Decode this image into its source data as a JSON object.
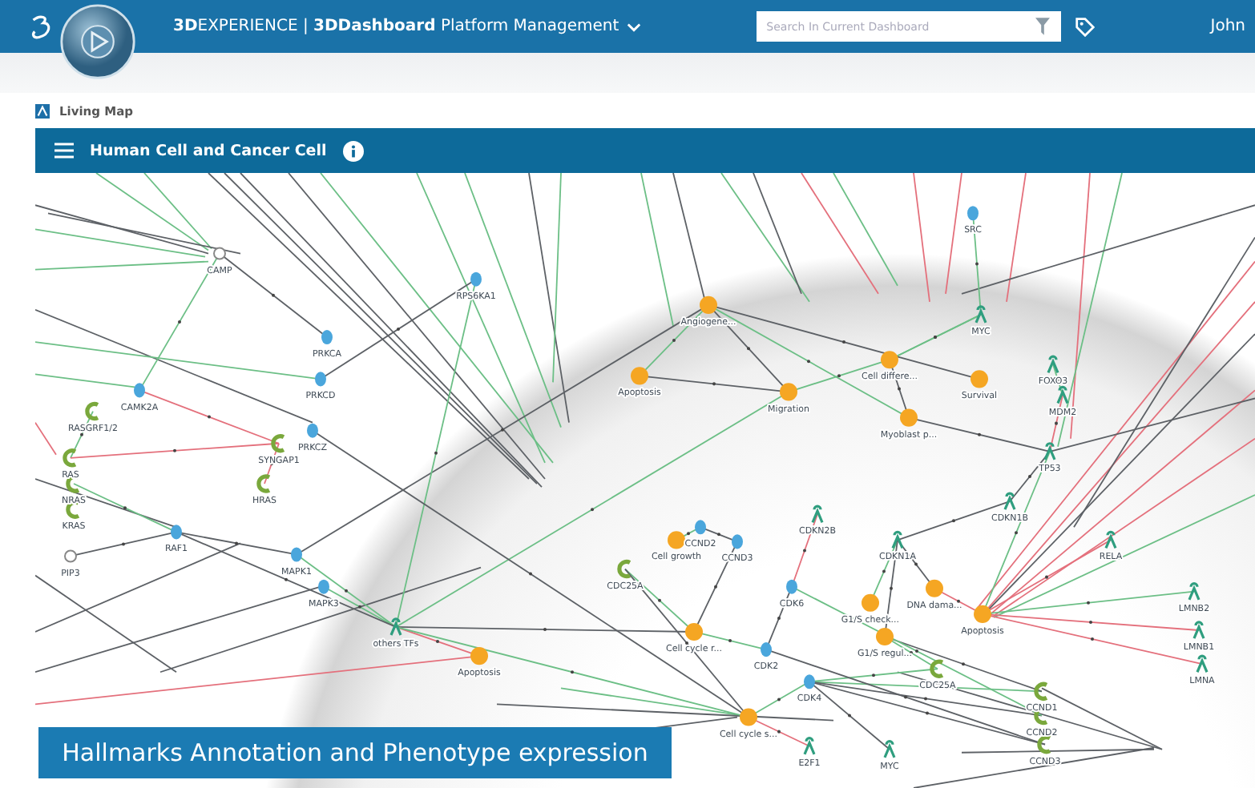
{
  "top_bar": {
    "title": "**3D**EXPERIENCE | **3DDashboard** Platform Management",
    "search": {
      "placeholder": "Search In Current Dashboard"
    },
    "user": "John"
  },
  "tab": {
    "label": "Living Map"
  },
  "panel": {
    "title": "Human Cell and Cancer Cell"
  },
  "map": {
    "nodes": [
      {
        "label": "SRC",
        "kind": "protein"
      },
      {
        "label": "CAMP",
        "kind": "molecule"
      },
      {
        "label": "RPS6KA1",
        "kind": "protein"
      },
      {
        "label": "Angiogene...",
        "kind": "phenotype"
      },
      {
        "label": "MYC",
        "kind": "gene"
      },
      {
        "label": "PRKCA",
        "kind": "protein"
      },
      {
        "label": "Cell differe...",
        "kind": "phenotype"
      },
      {
        "label": "FOXO3",
        "kind": "gene"
      },
      {
        "label": "PRKCD",
        "kind": "protein"
      },
      {
        "label": "Apoptosis",
        "kind": "phenotype"
      },
      {
        "label": "Survival",
        "kind": "phenotype"
      },
      {
        "label": "CAMK2A",
        "kind": "protein"
      },
      {
        "label": "Migration",
        "kind": "phenotype"
      },
      {
        "label": "MDM2",
        "kind": "gene"
      },
      {
        "label": "RASGRF1/2",
        "kind": "receptor"
      },
      {
        "label": "Myoblast p...",
        "kind": "phenotype"
      },
      {
        "label": "PRKCZ",
        "kind": "protein"
      },
      {
        "label": "SYNGAP1",
        "kind": "receptor"
      },
      {
        "label": "RAS",
        "kind": "receptor"
      },
      {
        "label": "TP53",
        "kind": "gene"
      },
      {
        "label": "NRAS",
        "kind": "receptor"
      },
      {
        "label": "HRAS",
        "kind": "receptor"
      },
      {
        "label": "KRAS",
        "kind": "receptor"
      },
      {
        "label": "CDKN1B",
        "kind": "gene"
      },
      {
        "label": "CDKN2B",
        "kind": "gene"
      },
      {
        "label": "RAF1",
        "kind": "protein"
      },
      {
        "label": "CCND2",
        "kind": "protein"
      },
      {
        "label": "Cell growth",
        "kind": "phenotype"
      },
      {
        "label": "CCND3",
        "kind": "protein"
      },
      {
        "label": "CDKN1A",
        "kind": "gene"
      },
      {
        "label": "RELA",
        "kind": "gene"
      },
      {
        "label": "PIP3",
        "kind": "molecule"
      },
      {
        "label": "MAPK1",
        "kind": "protein"
      },
      {
        "label": "CDC25A",
        "kind": "receptor"
      },
      {
        "label": "MAPK3",
        "kind": "protein"
      },
      {
        "label": "CDK6",
        "kind": "protein"
      },
      {
        "label": "DNA dama...",
        "kind": "phenotype"
      },
      {
        "label": "LMNB2",
        "kind": "gene"
      },
      {
        "label": "G1/S check...",
        "kind": "phenotype"
      },
      {
        "label": "Apoptosis",
        "kind": "phenotype"
      },
      {
        "label": "others TFs",
        "kind": "gene"
      },
      {
        "label": "Cell cycle r...",
        "kind": "phenotype"
      },
      {
        "label": "G1/S regul...",
        "kind": "phenotype"
      },
      {
        "label": "LMNB1",
        "kind": "gene"
      },
      {
        "label": "Apoptosis",
        "kind": "phenotype"
      },
      {
        "label": "CDK2",
        "kind": "protein"
      },
      {
        "label": "CDC25A",
        "kind": "receptor"
      },
      {
        "label": "LMNA",
        "kind": "gene"
      },
      {
        "label": "CDK4",
        "kind": "protein"
      },
      {
        "label": "CCND1",
        "kind": "receptor"
      },
      {
        "label": "Cell cycle s...",
        "kind": "phenotype"
      },
      {
        "label": "CCND2",
        "kind": "receptor"
      },
      {
        "label": "E2F1",
        "kind": "gene"
      },
      {
        "label": "MYC",
        "kind": "gene"
      },
      {
        "label": "CCND3",
        "kind": "receptor"
      }
    ]
  },
  "caption": "Hallmarks Annotation and Phenotype expression"
}
